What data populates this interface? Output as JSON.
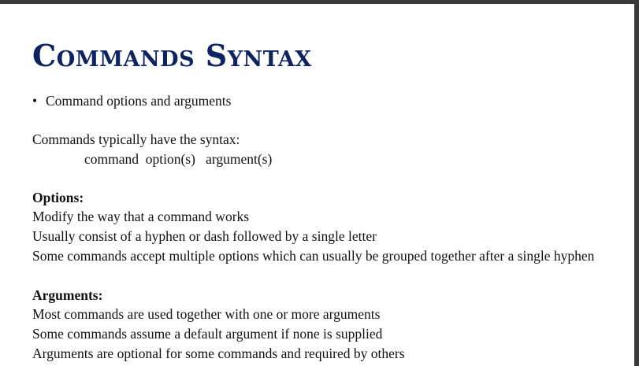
{
  "slide": {
    "title": "Commands Syntax",
    "bullet": "Command options and arguments",
    "syntax_intro": "Commands typically have the syntax:",
    "syntax_example": "command  option(s)   argument(s)",
    "options": {
      "heading": "Options:",
      "lines": [
        "Modify the way that a command works",
        "Usually consist of a hyphen or dash followed by a single letter",
        "Some commands accept multiple options which can usually be grouped together after a single hyphen"
      ]
    },
    "arguments": {
      "heading": "Arguments:",
      "lines": [
        "Most commands are used together with one or more arguments",
        "Some commands assume a default argument if none is supplied",
        "Arguments are optional for some commands and required by others"
      ]
    }
  },
  "colors": {
    "title": "#0d2461",
    "text": "#111111",
    "background": "#ffffff",
    "frame": "#3a3a3a"
  }
}
